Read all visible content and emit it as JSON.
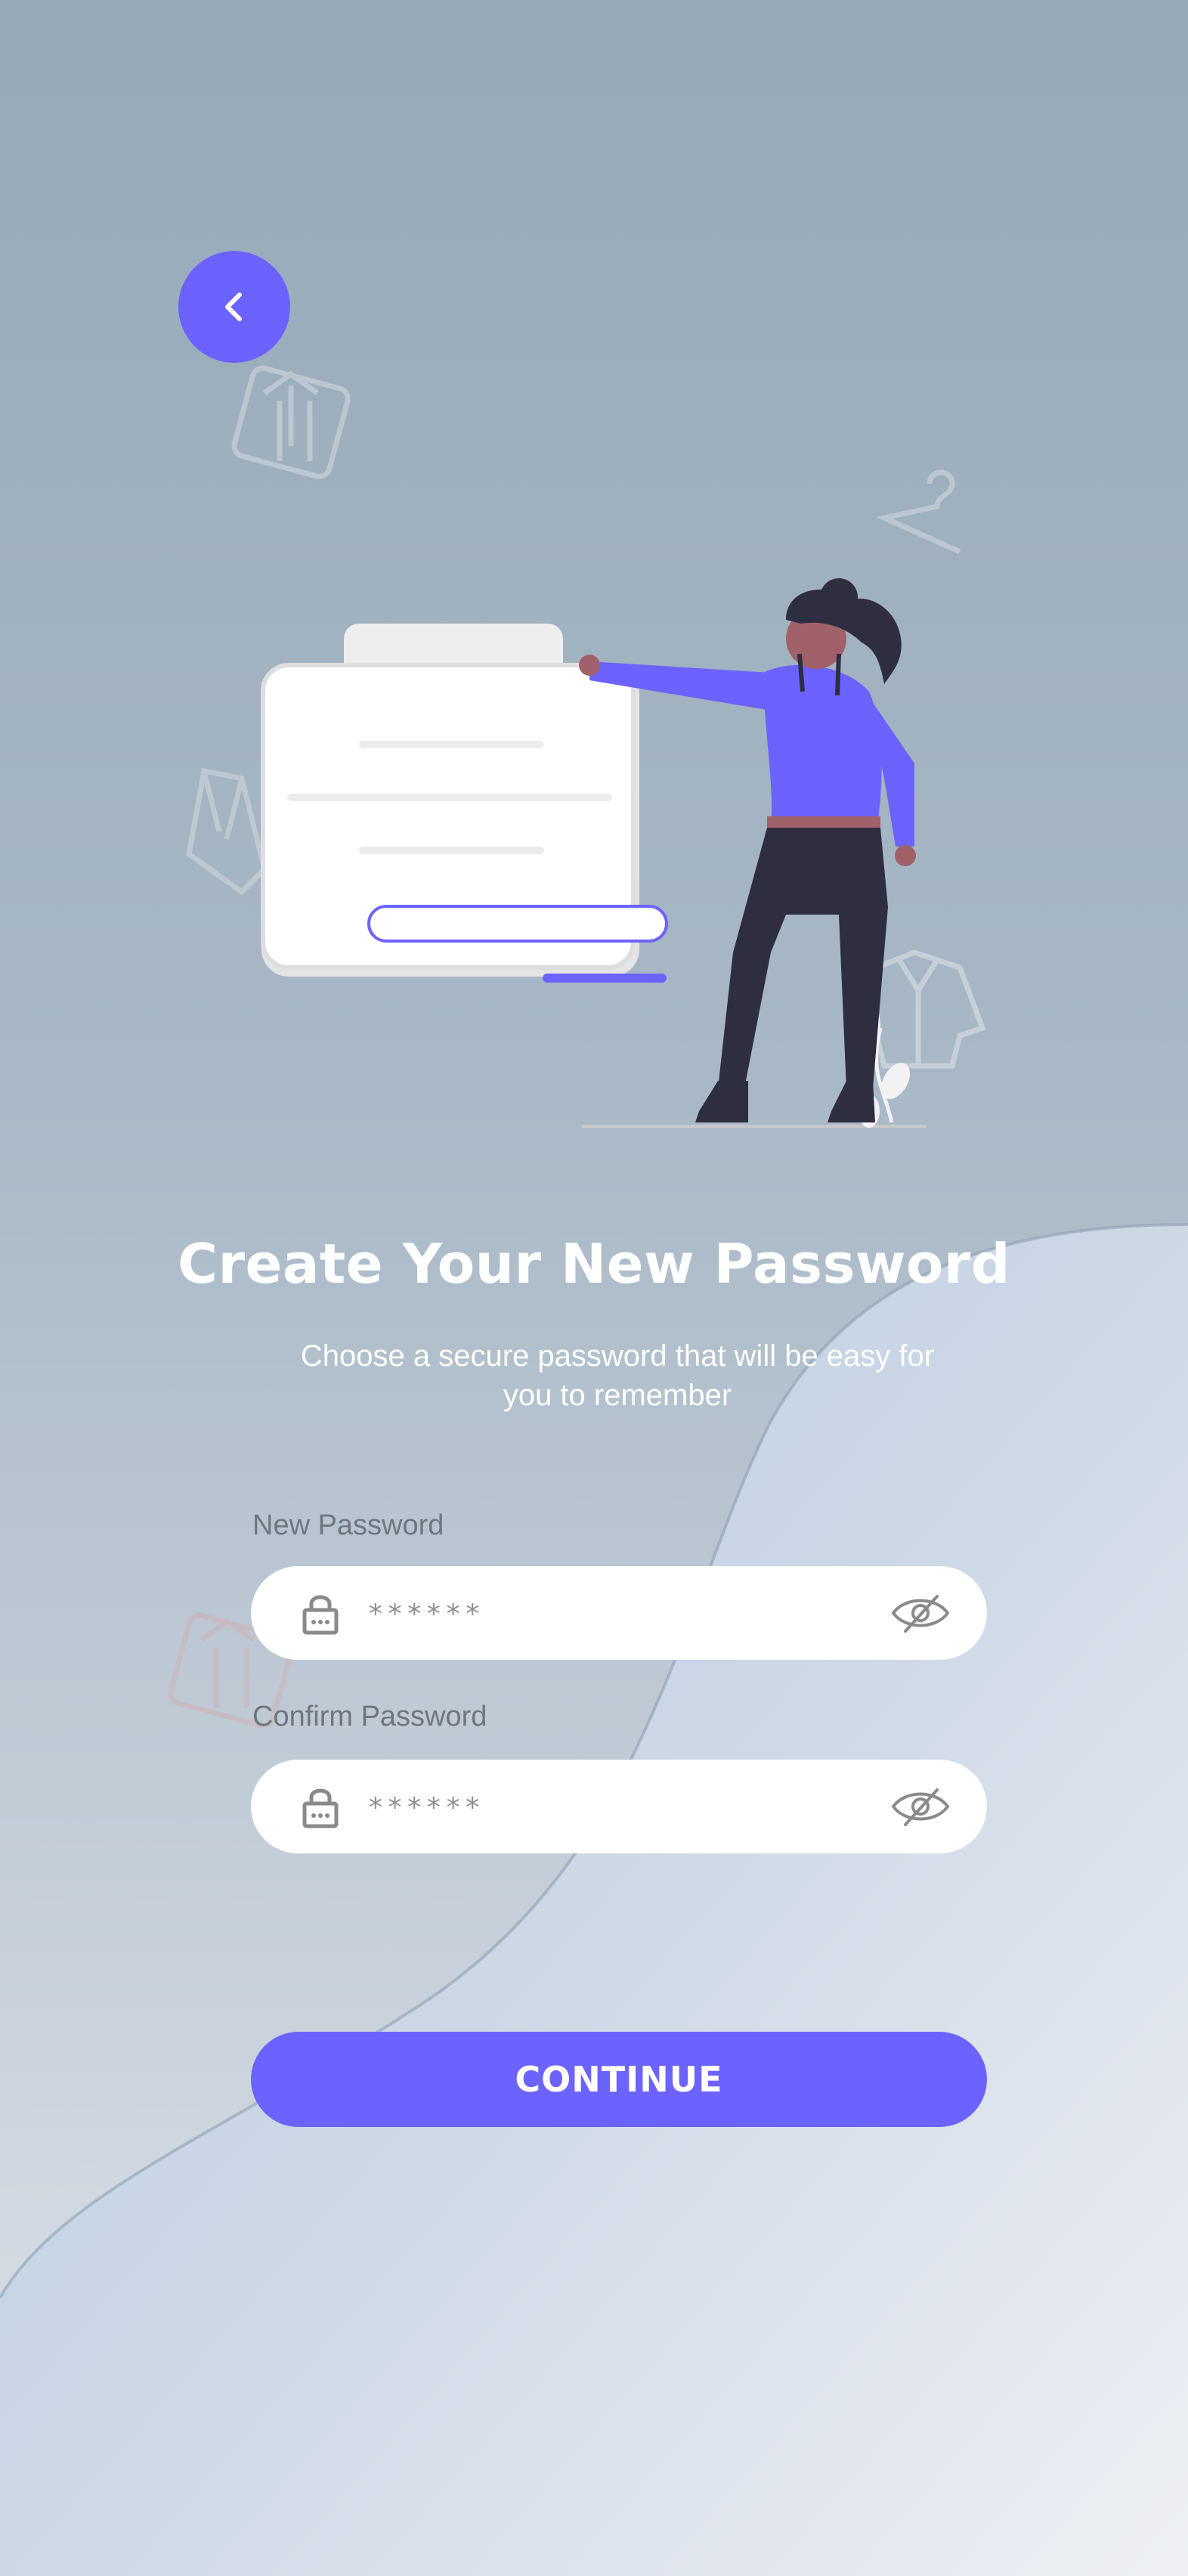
{
  "screen": {
    "title": "Create Your New Password",
    "subtitle": "Choose a secure password that will be easy for you to remember"
  },
  "back_button": {
    "icon": "chevron-left-icon"
  },
  "form": {
    "new_password": {
      "label": "New Password",
      "value": "******",
      "icon_left": "lock-icon",
      "icon_right": "eye-off-icon"
    },
    "confirm_password": {
      "label": "Confirm Password",
      "value": "******",
      "icon_left": "lock-icon",
      "icon_right": "eye-off-icon"
    }
  },
  "continue_button": {
    "label": "CONTINUE"
  },
  "colors": {
    "accent": "#6c63ff",
    "background_top": "#97a9b9",
    "background_bottom": "#dde3ea",
    "text_on_bg": "#ffffff",
    "label_text": "#6f7680",
    "icon_gray": "#8a8a8a",
    "figure_dark": "#2f2e41"
  }
}
